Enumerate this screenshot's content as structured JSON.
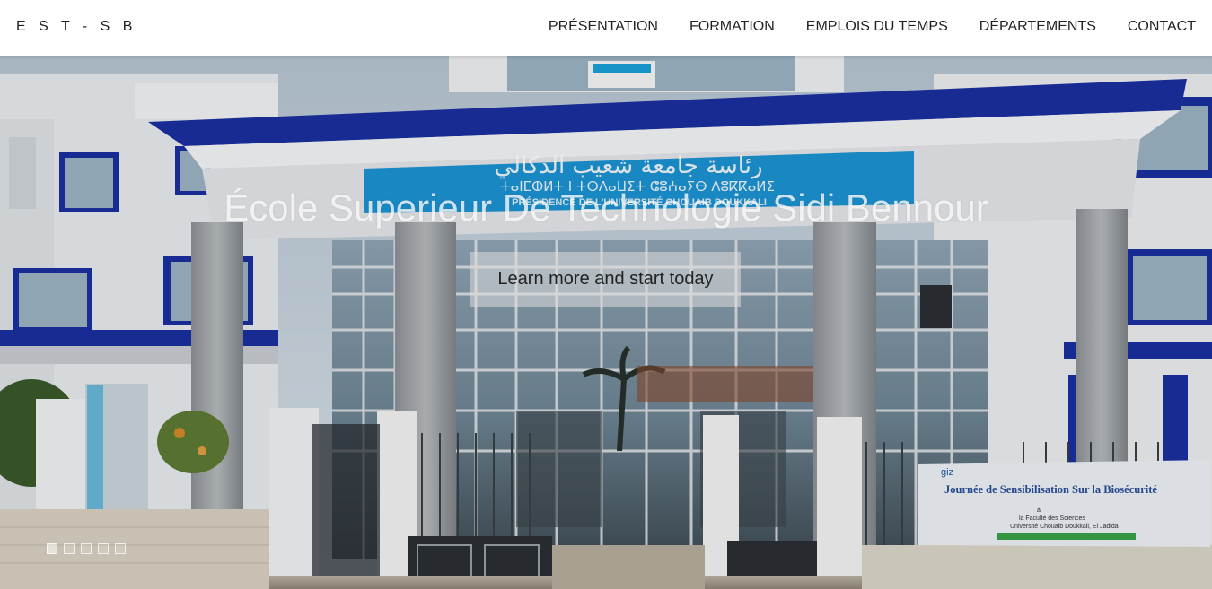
{
  "brand": {
    "name": "E S T - S B"
  },
  "nav": {
    "items": [
      {
        "label": "PRÉSENTATION"
      },
      {
        "label": "FORMATION"
      },
      {
        "label": "EMPLOIS DU TEMPS"
      },
      {
        "label": "DÉPARTEMENTS"
      },
      {
        "label": "CONTACT"
      }
    ]
  },
  "hero": {
    "title": "École Superieur De Technologie Sidi Bennour",
    "cta_label": "Learn more and start today",
    "slides": [
      {
        "active": true
      },
      {
        "active": false
      },
      {
        "active": false
      },
      {
        "active": false
      },
      {
        "active": false
      }
    ],
    "signage": {
      "arabic": "رئاسة جامعة شعيب الدكالي",
      "tifinagh": "ⵜⴰⵏⵎⵀⵍⵜ ⵏ ⵜⵙⴷⴰⵡⵉⵜ ⵛⵓⵄⴰⵢⴱ ⴷⵓⴽⴽⴰⵍⵉ",
      "french": "PRÉSIDENCE DE L'UNIVERSITÉ CHOUAIB DOUKKALI"
    },
    "banner": {
      "logo": "giz",
      "title": "Journée de Sensibilisation Sur la Biosécurité",
      "line1": "à",
      "line2": "la Faculté des Sciences",
      "line3": "Université Chouaib Doukkali, El Jadida"
    }
  },
  "colors": {
    "accent_blue": "#1b2fa0",
    "nav_text": "#222222",
    "sky": "#c8d7e3"
  }
}
